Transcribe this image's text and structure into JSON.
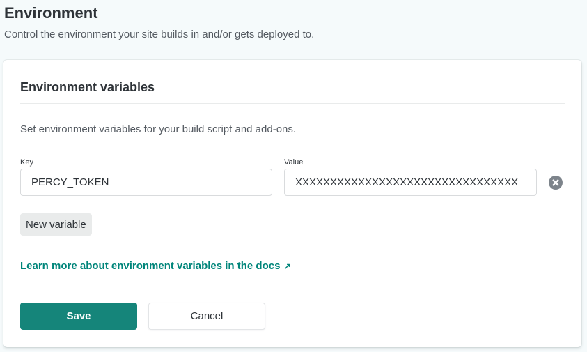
{
  "header": {
    "title": "Environment",
    "subtitle": "Control the environment your site builds in and/or gets deployed to."
  },
  "env_vars_card": {
    "title": "Environment variables",
    "description": "Set environment variables for your build script and add-ons.",
    "key_label": "Key",
    "value_label": "Value",
    "variables": [
      {
        "key": "PERCY_TOKEN",
        "value": "XXXXXXXXXXXXXXXXXXXXXXXXXXXXXXXX"
      }
    ],
    "remove_icon": "close-circle-icon",
    "new_variable_label": "New variable",
    "docs_link_text": "Learn more about environment variables in the docs",
    "docs_link_icon": "external-arrow-icon",
    "save_label": "Save",
    "cancel_label": "Cancel"
  },
  "colors": {
    "accent": "#15857a",
    "link": "#00857a",
    "background": "#f5fafb",
    "remove_icon": "#7d848b"
  }
}
